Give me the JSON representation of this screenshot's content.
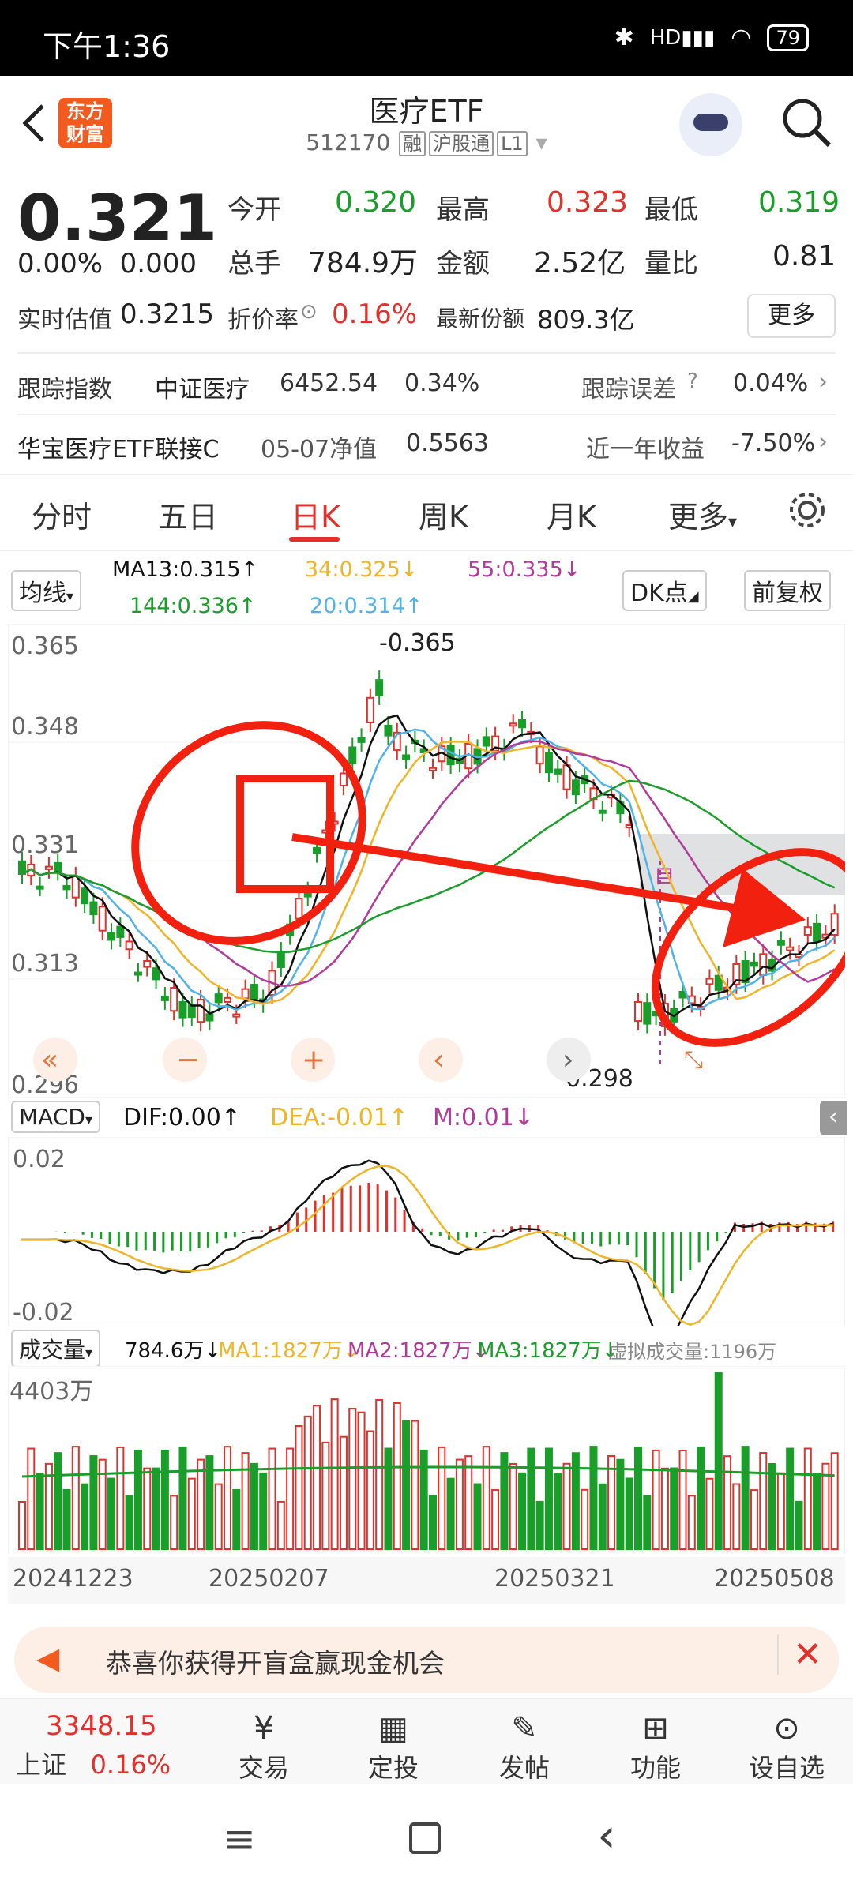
{
  "status_bar": {
    "time": "下午1:36",
    "battery": "79",
    "net": "HD"
  },
  "header": {
    "back_icon": "chevron-left-icon",
    "logo_text_1": "东方",
    "logo_text_2": "财富",
    "title": "医疗ETF",
    "code": "512170",
    "tags": [
      "融",
      "沪股通",
      "L1"
    ]
  },
  "quote": {
    "price": "0.321",
    "change_pct": "0.00%",
    "change_amt": "0.000",
    "open_label": "今开",
    "open": "0.320",
    "high_label": "最高",
    "high": "0.323",
    "low_label": "最低",
    "low": "0.319",
    "volume_label": "总手",
    "volume": "784.9万",
    "amount_label": "金额",
    "amount": "2.52亿",
    "ratio_label": "量比",
    "ratio": "0.81",
    "est_label": "实时估值",
    "est": "0.3215",
    "premium_label": "折价率",
    "premium": "0.16%",
    "shares_label": "最新份额",
    "shares": "809.3亿",
    "more": "更多"
  },
  "tracking": {
    "index_label": "跟踪指数",
    "index_name": "中证医疗",
    "index_value": "6452.54",
    "index_pct": "0.34%",
    "error_label": "跟踪误差",
    "error_value": "0.04%",
    "fund_name": "华宝医疗ETF联接C",
    "nav_label": "05-07净值",
    "nav_value": "0.5563",
    "year_label": "近一年收益",
    "year_value": "-7.50%"
  },
  "tabs": [
    "分时",
    "五日",
    "日K",
    "周K",
    "月K",
    "更多"
  ],
  "indicators": {
    "ma_select": "均线",
    "ma13": "MA13:0.315↑",
    "ma34": "34:0.325↓",
    "ma55": "55:0.335↓",
    "ma144": "144:0.336↑",
    "ma20": "20:0.314↑",
    "dk": "DK点",
    "adjust": "前复权"
  },
  "kchart": {
    "y_labels": [
      "0.365",
      "0.348",
      "0.331",
      "0.313",
      "0.296"
    ],
    "high_label": "-0.365",
    "low_label": "0.298",
    "overlay_text": "自"
  },
  "macd": {
    "select": "MACD",
    "dif": "DIF:0.00↑",
    "dea": "DEA:-0.01↑",
    "m": "M:0.01↓",
    "y_top": "0.02",
    "y_bot": "-0.02"
  },
  "volume": {
    "select": "成交量",
    "vol": "784.6万↓",
    "ma1": "MA1:1827万↓",
    "ma2": "MA2:1827万↓",
    "ma3": "MA3:1827万↓",
    "virtual": "虚拟成交量:1196万",
    "y_top": "4403万",
    "dates": [
      "20241223",
      "20250207",
      "20250321",
      "20250508"
    ]
  },
  "banner": {
    "text": "恭喜你获得开盲盒赢现金机会"
  },
  "bottom_nav": {
    "index_value": "3348.15",
    "index_name": "上证",
    "index_pct": "0.16%",
    "items": [
      "交易",
      "定投",
      "发帖",
      "功能",
      "设自选"
    ]
  },
  "colors": {
    "up": "#e2302b",
    "down": "#1a9e2a",
    "accent": "#e2302b",
    "ma13": "#111111",
    "ma20": "#4fb3e8",
    "ma34": "#f0b429",
    "ma55": "#b23a9a",
    "ma144": "#1a9e2a"
  }
}
